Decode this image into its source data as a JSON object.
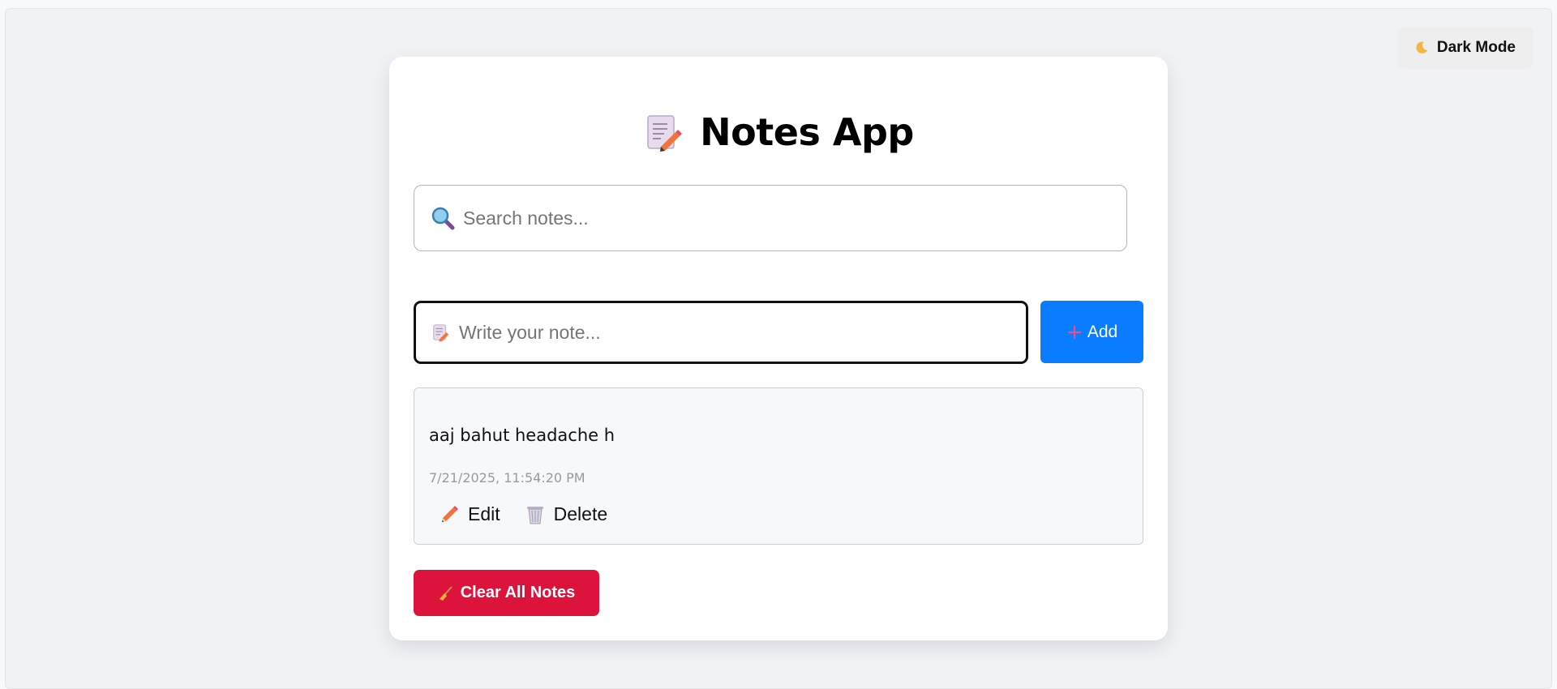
{
  "header": {
    "dark_mode_label": "Dark Mode",
    "dark_mode_icon": "moon-icon"
  },
  "app": {
    "title": "Notes App",
    "title_icon": "memo-icon"
  },
  "search": {
    "placeholder": "Search notes...",
    "value": "",
    "icon": "magnifier-icon"
  },
  "composer": {
    "placeholder": "Write your note...",
    "value": "",
    "icon": "memo-icon",
    "add_label": "Add",
    "add_icon": "plus-icon",
    "accent": "#0a7cff"
  },
  "notes": [
    {
      "text": "aaj bahut headache h",
      "timestamp": "7/21/2025, 11:54:20 PM",
      "edit_label": "Edit",
      "edit_icon": "pencil-icon",
      "delete_label": "Delete",
      "delete_icon": "wastebasket-icon"
    }
  ],
  "footer": {
    "clear_label": "Clear All Notes",
    "clear_icon": "broom-icon",
    "danger_color": "#dc143c"
  }
}
